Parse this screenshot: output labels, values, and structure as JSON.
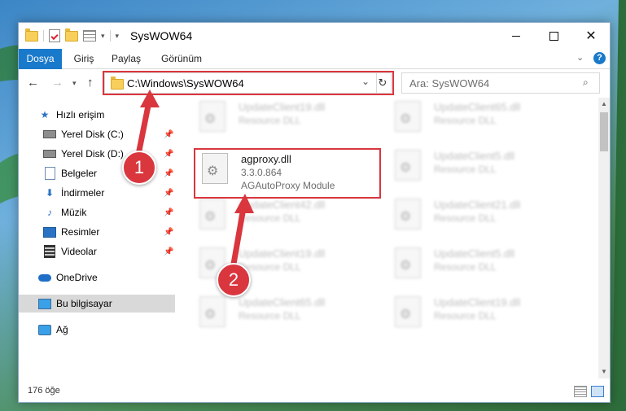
{
  "window": {
    "title": "SysWOW64"
  },
  "ribbon": {
    "tabs": [
      "Dosya",
      "Giriş",
      "Paylaş",
      "Görünüm"
    ],
    "help": "?"
  },
  "address": {
    "path": "C:\\Windows\\SysWOW64",
    "search_placeholder": "Ara: SysWOW64"
  },
  "sidebar": {
    "items": [
      {
        "label": "Hızlı erişim",
        "icon": "star-icon"
      },
      {
        "label": "Yerel Disk (C:)",
        "icon": "drive-icon",
        "pinned": true
      },
      {
        "label": "Yerel Disk (D:)",
        "icon": "drive-icon",
        "pinned": true
      },
      {
        "label": "Belgeler",
        "icon": "documents-icon",
        "pinned": true
      },
      {
        "label": "İndirmeler",
        "icon": "downloads-icon",
        "pinned": true
      },
      {
        "label": "Müzik",
        "icon": "music-icon",
        "pinned": true
      },
      {
        "label": "Resimler",
        "icon": "pictures-icon",
        "pinned": true
      },
      {
        "label": "Videolar",
        "icon": "videos-icon",
        "pinned": true
      },
      {
        "label": "OneDrive",
        "icon": "onedrive-icon"
      },
      {
        "label": "Bu bilgisayar",
        "icon": "computer-icon",
        "selected": true
      },
      {
        "label": "Ağ",
        "icon": "network-icon"
      }
    ]
  },
  "files": {
    "left": [
      {
        "name": "UpdateClient19.dll",
        "desc": "Resource DLL"
      },
      {
        "name": "UpdateClient42.dll",
        "desc": "Resource DLL"
      },
      {
        "name": "UpdateClient19.dll",
        "desc": "Resource DLL"
      },
      {
        "name": "UpdateClient65.dll",
        "desc": "Resource DLL"
      }
    ],
    "right": [
      {
        "name": "UpdateClient65.dll",
        "desc": "Resource DLL"
      },
      {
        "name": "UpdateClient5.dll",
        "desc": "Resource DLL"
      },
      {
        "name": "UpdateClient21.dll",
        "desc": "Resource DLL"
      },
      {
        "name": "UpdateClient5.dll",
        "desc": "Resource DLL"
      },
      {
        "name": "UpdateClient19.dll",
        "desc": "Resource DLL"
      }
    ],
    "featured": {
      "name": "agproxy.dll",
      "version": "3.3.0.864",
      "desc": "AGAutoProxy Module"
    }
  },
  "status": {
    "count": "176 öğe"
  },
  "annotations": {
    "step1": "1",
    "step2": "2",
    "color": "#d9363e"
  }
}
